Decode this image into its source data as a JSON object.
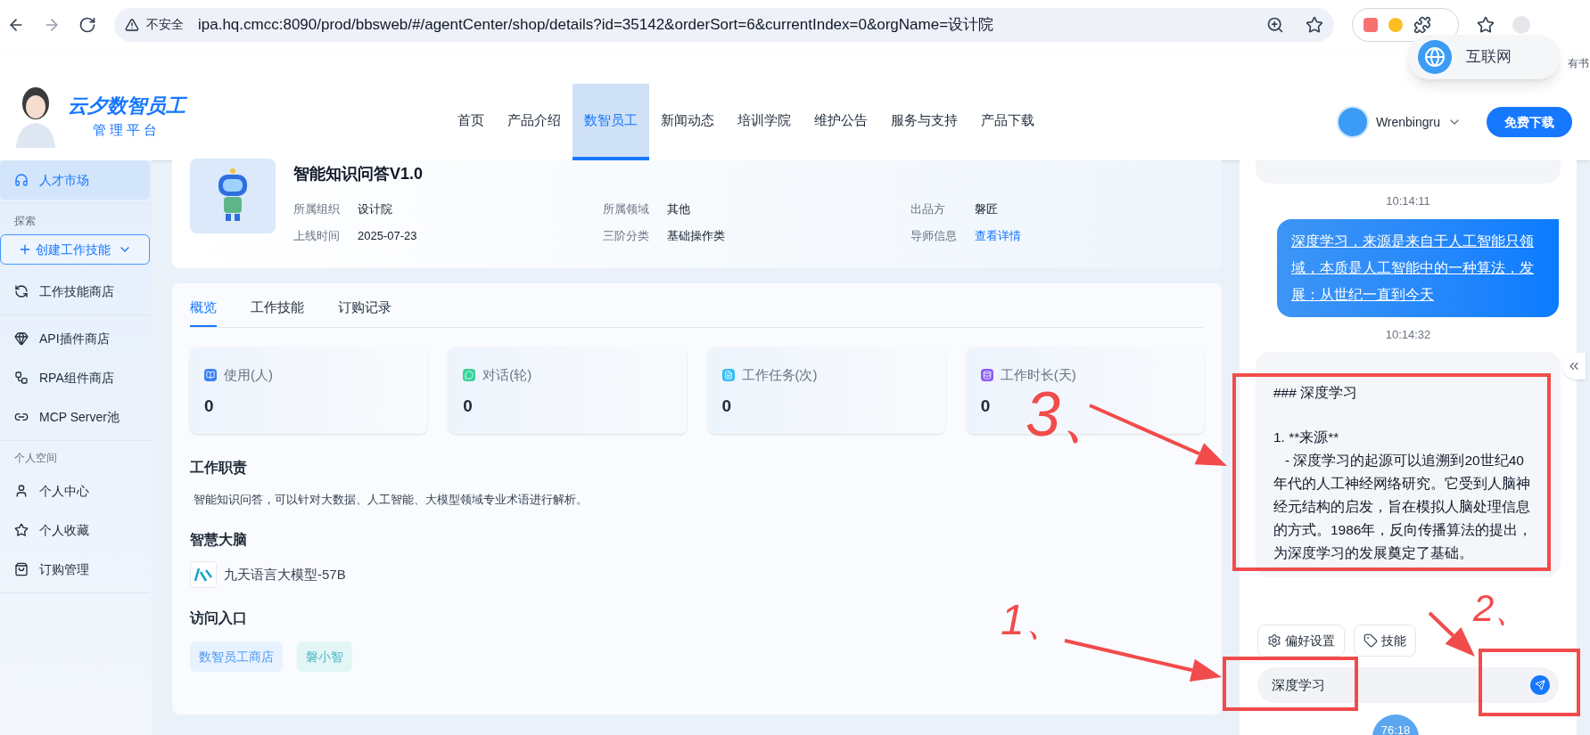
{
  "browser": {
    "security_label": "不安全",
    "url": "ipa.hq.cmcc:8090/prod/bbsweb/#/agentCenter/shop/details?id=35142&orderSort=6&currentIndex=0&orgName=设计院",
    "overlay_badge": "互联网",
    "edge_text": "有书"
  },
  "header": {
    "logo_title": "云夕数智员工",
    "logo_subtitle": "管理平台",
    "nav": [
      {
        "label": "首页",
        "selected": false
      },
      {
        "label": "产品介绍",
        "selected": false
      },
      {
        "label": "数智员工",
        "selected": true
      },
      {
        "label": "新闻动态",
        "selected": false
      },
      {
        "label": "培训学院",
        "selected": false
      },
      {
        "label": "维护公告",
        "selected": false
      },
      {
        "label": "服务与支持",
        "selected": false
      },
      {
        "label": "产品下载",
        "selected": false
      }
    ],
    "user": "Wrenbingru",
    "download_button": "免费下载"
  },
  "sidebar": {
    "items": [
      {
        "kind": "item",
        "label": "人才市场",
        "selected": true
      },
      {
        "kind": "divider"
      },
      {
        "kind": "section",
        "label": "探索"
      },
      {
        "kind": "button",
        "label": "创建工作技能"
      },
      {
        "kind": "item",
        "label": "工作技能商店",
        "selected": false
      },
      {
        "kind": "divider"
      },
      {
        "kind": "item",
        "label": "API插件商店",
        "selected": false
      },
      {
        "kind": "item",
        "label": "RPA组件商店",
        "selected": false
      },
      {
        "kind": "item",
        "label": "MCP Server池",
        "selected": false
      },
      {
        "kind": "divider"
      },
      {
        "kind": "section",
        "label": "个人空间"
      },
      {
        "kind": "item",
        "label": "个人中心",
        "selected": false
      },
      {
        "kind": "item",
        "label": "个人收藏",
        "selected": false
      },
      {
        "kind": "item",
        "label": "订购管理",
        "selected": false
      },
      {
        "kind": "divider"
      }
    ]
  },
  "profile": {
    "title": "智能知识问答V1.0",
    "fields": [
      {
        "label": "所属组织",
        "value": "设计院",
        "kind": "text"
      },
      {
        "label": "所属领域",
        "value": "其他",
        "kind": "text"
      },
      {
        "label": "出品方",
        "value": "磐匠",
        "kind": "text"
      },
      {
        "label": "上线时间",
        "value": "2025-07-23",
        "kind": "text"
      },
      {
        "label": "三阶分类",
        "value": "基础操作类",
        "kind": "text"
      },
      {
        "label": "导师信息",
        "value": "查看详情",
        "kind": "link"
      }
    ]
  },
  "tabs": [
    {
      "label": "概览",
      "selected": true
    },
    {
      "label": "工作技能",
      "selected": false
    },
    {
      "label": "订购记录",
      "selected": false
    }
  ],
  "stats": [
    {
      "label": "使用(人)",
      "value": "0",
      "color": "#3b82f6"
    },
    {
      "label": "对话(轮)",
      "value": "0",
      "color": "#34d399"
    },
    {
      "label": "工作任务(次)",
      "value": "0",
      "color": "#38bdf8"
    },
    {
      "label": "工作时长(天)",
      "value": "0",
      "color": "#8b5cf6"
    }
  ],
  "duty": {
    "heading": "工作职责",
    "text": "智能知识问答，可以针对大数据、人工智能、大模型领域专业术语进行解析。"
  },
  "brain": {
    "heading": "智慧大脑",
    "model": "九天语言大模型-57B"
  },
  "entry": {
    "heading": "访问入口",
    "tags": [
      {
        "label": "数智员工商店",
        "color": "#e8f2fe"
      },
      {
        "label": "磐小智",
        "color": "#e3f6f6"
      }
    ]
  },
  "chat": {
    "messages": [
      {
        "kind": "time",
        "text": "10:14:11"
      },
      {
        "kind": "user",
        "text": "深度学习，来源是来自于人工智能只领域，本质是人工智能中的一种算法，发展：从世纪一直到今天"
      },
      {
        "kind": "time",
        "text": "10:14:32"
      },
      {
        "kind": "assistant",
        "lines": [
          "### 深度学习",
          "1. **来源**",
          "   - 深度学习的起源可以追溯到20世纪40年代的人工神经网络研究。它受到人脑神经元结构的启发，旨在模拟人脑处理信息的方式。1986年，反向传播算法的提出，为深度学习的发展奠定了基础。"
        ]
      }
    ],
    "tools": [
      "偏好设置",
      "技能"
    ],
    "input_value": "深度学习",
    "timer": "76:18"
  },
  "annotations": [
    {
      "label": "3、"
    },
    {
      "label": "1、"
    },
    {
      "label": "2、"
    }
  ]
}
